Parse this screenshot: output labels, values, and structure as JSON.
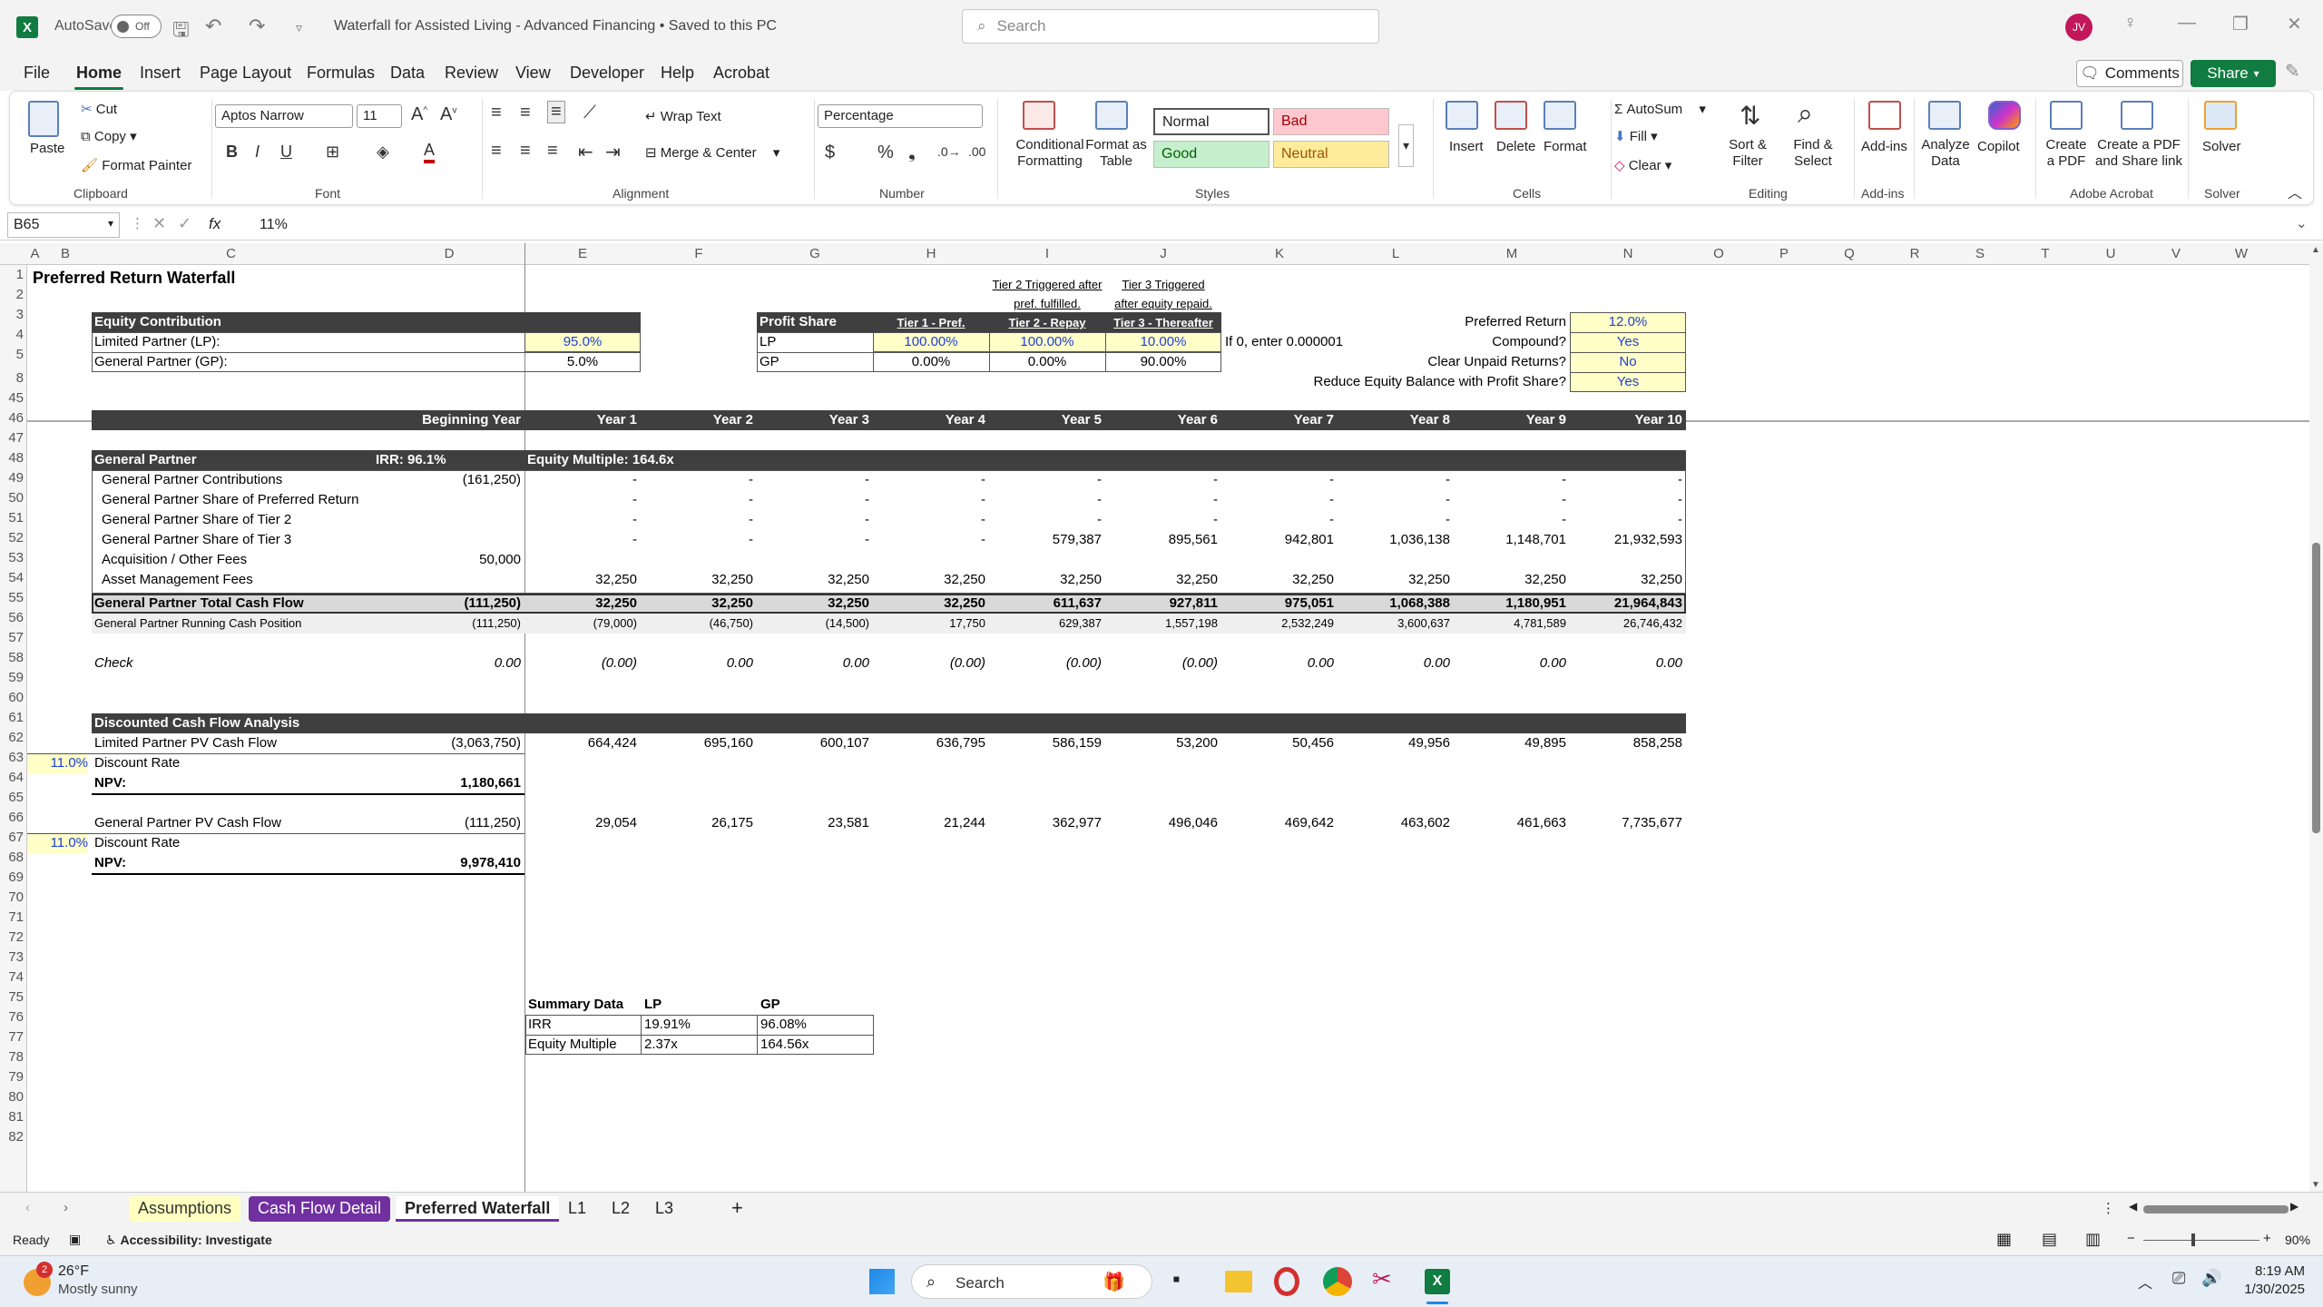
{
  "window": {
    "autosave_label": "AutoSave",
    "autosave_state": "Off",
    "title": "Waterfall for Assisted Living - Advanced Financing  •  Saved to this PC",
    "search_placeholder": "Search",
    "user_initials": "JV"
  },
  "menu": {
    "items": [
      "File",
      "Home",
      "Insert",
      "Page Layout",
      "Formulas",
      "Data",
      "Review",
      "View",
      "Developer",
      "Help",
      "Acrobat"
    ],
    "comments": "Comments",
    "share": "Share"
  },
  "ribbon": {
    "paste": "Paste",
    "cut": "Cut",
    "copy": "Copy",
    "format_painter": "Format Painter",
    "clipboard": "Clipboard",
    "font_name": "Aptos Narrow",
    "font_size": "11",
    "font": "Font",
    "wrap_text": "Wrap Text",
    "merge_center": "Merge & Center",
    "alignment": "Alignment",
    "number_format": "Percentage",
    "number": "Number",
    "conditional_formatting": "Conditional\nFormatting",
    "format_as_table": "Format as\nTable",
    "style_normal": "Normal",
    "style_bad": "Bad",
    "style_good": "Good",
    "style_neutral": "Neutral",
    "styles": "Styles",
    "insert": "Insert",
    "delete": "Delete",
    "format": "Format",
    "cells": "Cells",
    "autosum": "AutoSum",
    "fill": "Fill",
    "clear": "Clear",
    "sort_filter": "Sort &\nFilter",
    "find_select": "Find &\nSelect",
    "editing": "Editing",
    "addins": "Add-ins",
    "addins_group": "Add-ins",
    "analyze_data": "Analyze\nData",
    "copilot": "Copilot",
    "create_pdf": "Create\na PDF",
    "create_pdf_share": "Create a PDF\nand Share link",
    "adobe_acrobat": "Adobe Acrobat",
    "solver": "Solver",
    "solver_group": "Solver"
  },
  "formula_bar": {
    "name_box": "B65",
    "fx": "fx",
    "formula": "11%"
  },
  "columns": [
    "A",
    "B",
    "C",
    "D",
    "E",
    "F",
    "G",
    "H",
    "I",
    "J",
    "K",
    "L",
    "M",
    "N",
    "O",
    "P",
    "Q",
    "R",
    "S",
    "T",
    "U",
    "V",
    "W"
  ],
  "rows": [
    "1",
    "2",
    "3",
    "4",
    "5",
    "8",
    "45",
    "46",
    "47",
    "48",
    "49",
    "50",
    "51",
    "52",
    "53",
    "54",
    "55",
    "56",
    "57",
    "58",
    "59",
    "60",
    "61",
    "62",
    "63",
    "64",
    "65",
    "66",
    "67",
    "68",
    "69",
    "70",
    "71",
    "72",
    "73",
    "74",
    "75",
    "76",
    "77",
    "78",
    "79",
    "80",
    "81",
    "82"
  ],
  "sheet": {
    "title": "Preferred Return Waterfall",
    "equity_header": "Equity Contribution",
    "lp_label": "Limited Partner (LP):",
    "lp_value": "95.0%",
    "gp_label": "General Partner (GP):",
    "gp_value": "5.0%",
    "tier2_note1": "Tier 2 Triggered after",
    "tier2_note2": "pref. fulfilled.",
    "tier3_note1": "Tier 3 Triggered",
    "tier3_note2": "after equity repaid.",
    "profit_share": "Profit Share",
    "tier1": "Tier 1 - Pref.",
    "tier2": "Tier 2 - Repay",
    "tier3": "Tier 3 - Thereafter",
    "ps_lp": "LP",
    "ps_lp_t1": "100.00%",
    "ps_lp_t2": "100.00%",
    "ps_lp_t3": "10.00%",
    "ps_gp": "GP",
    "ps_gp_t1": "0.00%",
    "ps_gp_t2": "0.00%",
    "ps_gp_t3": "90.00%",
    "zero_note": "If 0, enter 0.000001",
    "pref_return_label": "Preferred Return",
    "pref_return": "12.0%",
    "compound_label": "Compound?",
    "compound": "Yes",
    "clear_unpaid_label": "Clear Unpaid Returns?",
    "clear_unpaid": "No",
    "reduce_equity_label": "Reduce Equity Balance with Profit Share?",
    "reduce_equity": "Yes",
    "year_headers": [
      "Beginning Year",
      "Year 1",
      "Year 2",
      "Year 3",
      "Year 4",
      "Year 5",
      "Year 6",
      "Year 7",
      "Year 8",
      "Year 9",
      "Year 10"
    ],
    "gp_header": "General Partner",
    "irr_label": "IRR: 96.1%",
    "equity_multiple_label": "Equity Multiple: 164.6x",
    "gp_rows": [
      {
        "label": "General Partner Contributions",
        "values": [
          "(161,250)",
          "-",
          "-",
          "-",
          "-",
          "-",
          "-",
          "-",
          "-",
          "-",
          "-"
        ]
      },
      {
        "label": "General Partner Share of Preferred Return",
        "values": [
          "",
          "-",
          "-",
          "-",
          "-",
          "-",
          "-",
          "-",
          "-",
          "-",
          "-"
        ]
      },
      {
        "label": "General Partner Share of Tier 2",
        "values": [
          "",
          "-",
          "-",
          "-",
          "-",
          "-",
          "-",
          "-",
          "-",
          "-",
          "-"
        ]
      },
      {
        "label": "General Partner Share of Tier 3",
        "values": [
          "",
          "-",
          "-",
          "-",
          "-",
          "579,387",
          "895,561",
          "942,801",
          "1,036,138",
          "1,148,701",
          "21,932,593"
        ]
      },
      {
        "label": "Acquisition / Other Fees",
        "values": [
          "50,000",
          "",
          "",
          "",
          "",
          "",
          "",
          "",
          "",
          "",
          ""
        ]
      },
      {
        "label": "Asset Management Fees",
        "values": [
          "",
          "32,250",
          "32,250",
          "32,250",
          "32,250",
          "32,250",
          "32,250",
          "32,250",
          "32,250",
          "32,250",
          "32,250"
        ]
      }
    ],
    "gp_total": {
      "label": "General Partner Total Cash Flow",
      "values": [
        "(111,250)",
        "32,250",
        "32,250",
        "32,250",
        "32,250",
        "611,637",
        "927,811",
        "975,051",
        "1,068,388",
        "1,180,951",
        "21,964,843"
      ]
    },
    "gp_running": {
      "label": "General Partner Running Cash Position",
      "values": [
        "(111,250)",
        "(79,000)",
        "(46,750)",
        "(14,500)",
        "17,750",
        "629,387",
        "1,557,198",
        "2,532,249",
        "3,600,637",
        "4,781,589",
        "26,746,432"
      ]
    },
    "check": {
      "label": "Check",
      "values": [
        "0.00",
        "(0.00)",
        "0.00",
        "0.00",
        "(0.00)",
        "(0.00)",
        "(0.00)",
        "0.00",
        "0.00",
        "0.00",
        "0.00"
      ]
    },
    "dcf_header": "Discounted Cash Flow Analysis",
    "lp_pv": {
      "label": "Limited Partner PV Cash Flow",
      "values": [
        "(3,063,750)",
        "664,424",
        "695,160",
        "600,107",
        "636,795",
        "586,159",
        "53,200",
        "50,456",
        "49,956",
        "49,895",
        "858,258"
      ]
    },
    "discount_rate_1": "11.0%",
    "discount_rate_label": "Discount Rate",
    "npv_label": "NPV:",
    "npv_1": "1,180,661",
    "gp_pv": {
      "label": "General Partner PV Cash Flow",
      "values": [
        "(111,250)",
        "29,054",
        "26,175",
        "23,581",
        "21,244",
        "362,977",
        "496,046",
        "469,642",
        "463,602",
        "461,663",
        "7,735,677"
      ]
    },
    "discount_rate_2": "11.0%",
    "npv_2": "9,978,410",
    "summary_header": "Summary Data",
    "summary_lp": "LP",
    "summary_gp": "GP",
    "irr_row": "IRR",
    "irr_lp": "19.91%",
    "irr_gp": "96.08%",
    "em_row": "Equity Multiple",
    "em_lp": "2.37x",
    "em_gp": "164.56x"
  },
  "tabs": [
    "Assumptions",
    "Cash Flow Detail",
    "Preferred Waterfall",
    "L1",
    "L2",
    "L3"
  ],
  "status": {
    "ready": "Ready",
    "accessibility": "Accessibility: Investigate",
    "zoom": "90%"
  },
  "taskbar": {
    "temp": "26°F",
    "weather": "Mostly sunny",
    "search": "Search",
    "time": "8:19 AM",
    "date": "1/30/2025",
    "badge": "2"
  }
}
